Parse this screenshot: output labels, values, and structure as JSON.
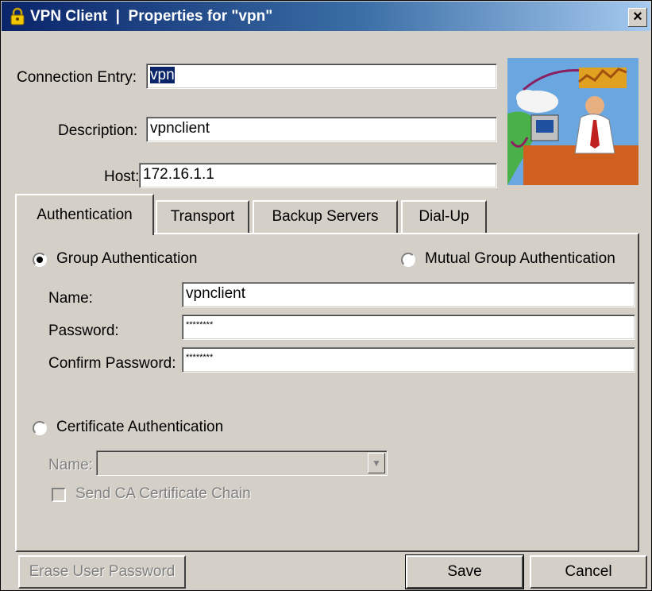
{
  "window": {
    "title": "VPN Client  |  Properties for \"vpn\"",
    "close_label": "×"
  },
  "entry": {
    "connection_label": "Connection Entry:",
    "connection_value": "vpn",
    "description_label": "Description:",
    "description_value": "vpnclient",
    "host_label": "Host:",
    "host_value": "172.16.1.1"
  },
  "tabs": [
    {
      "label": "Authentication",
      "active": true
    },
    {
      "label": "Transport",
      "active": false
    },
    {
      "label": "Backup Servers",
      "active": false
    },
    {
      "label": "Dial-Up",
      "active": false
    }
  ],
  "auth": {
    "group_radio_label": "Group Authentication",
    "group_selected": true,
    "mutual_radio_label": "Mutual Group Authentication",
    "mutual_selected": false,
    "name_label": "Name:",
    "name_value": "vpnclient",
    "password_label": "Password:",
    "password_value": "********",
    "confirm_label": "Confirm Password:",
    "confirm_value": "********",
    "cert_radio_label": "Certificate Authentication",
    "cert_selected": false,
    "cert_name_label": "Name:",
    "cert_name_value": "",
    "send_ca_label": "Send CA Certificate Chain",
    "send_ca_checked": false
  },
  "buttons": {
    "erase": "Erase User Password",
    "save": "Save",
    "cancel": "Cancel"
  },
  "icons": {
    "title": "vpn-lock-icon",
    "illustration": "user-at-computer-illustration"
  }
}
